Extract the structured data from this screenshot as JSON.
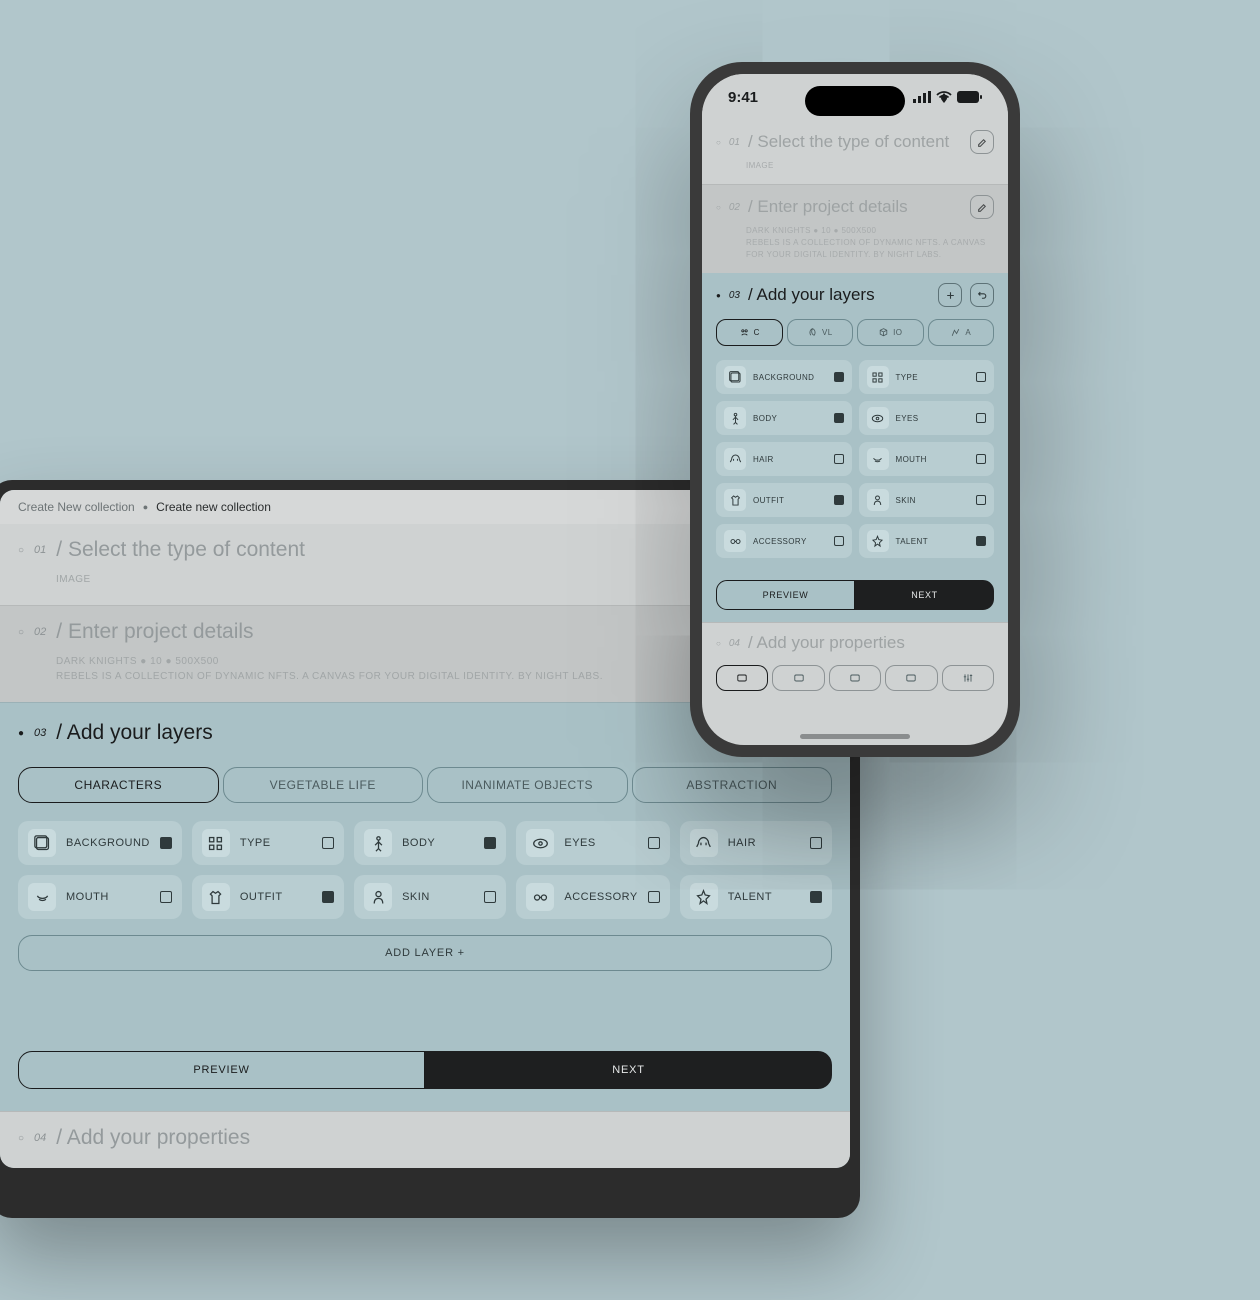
{
  "breadcrumb": {
    "parent": "Create New collection",
    "current": "Create new collection"
  },
  "steps": {
    "s1": {
      "num": "01",
      "title": "/ Select the type of content",
      "meta": "IMAGE"
    },
    "s2": {
      "num": "02",
      "title": "/ Enter project details",
      "meta1": "DARK KNIGHTS ● 10 ● 500X500",
      "meta2": "REBELS IS A COLLECTION OF DYNAMIC NFTS. A CANVAS FOR YOUR DIGITAL IDENTITY. BY NIGHT LABS."
    },
    "s3": {
      "num": "03",
      "title": "/ Add your layers"
    },
    "s4": {
      "num": "04",
      "title": "/ Add your properties"
    }
  },
  "categories": {
    "tabs": [
      "CHARACTERS",
      "VEGETABLE LIFE",
      "INANIMATE OBJECTS",
      "ABSTRACTION"
    ]
  },
  "phone_categories": {
    "tabs": [
      "C",
      "VL",
      "IO",
      "A"
    ]
  },
  "layers": [
    {
      "label": "BACKGROUND",
      "filled": true,
      "icon": "background"
    },
    {
      "label": "TYPE",
      "filled": false,
      "icon": "type"
    },
    {
      "label": "BODY",
      "filled": true,
      "icon": "body"
    },
    {
      "label": "EYES",
      "filled": false,
      "icon": "eyes"
    },
    {
      "label": "HAIR",
      "filled": false,
      "icon": "hair"
    },
    {
      "label": "MOUTH",
      "filled": false,
      "icon": "mouth"
    },
    {
      "label": "OUTFIT",
      "filled": true,
      "icon": "outfit"
    },
    {
      "label": "SKIN",
      "filled": false,
      "icon": "skin"
    },
    {
      "label": "ACCESSORY",
      "filled": false,
      "icon": "accessory"
    },
    {
      "label": "TALENT",
      "filled": true,
      "icon": "talent"
    }
  ],
  "buttons": {
    "add_layer": "ADD LAYER  +",
    "preview": "PREVIEW",
    "next": "NEXT"
  },
  "status_time": "9:41"
}
